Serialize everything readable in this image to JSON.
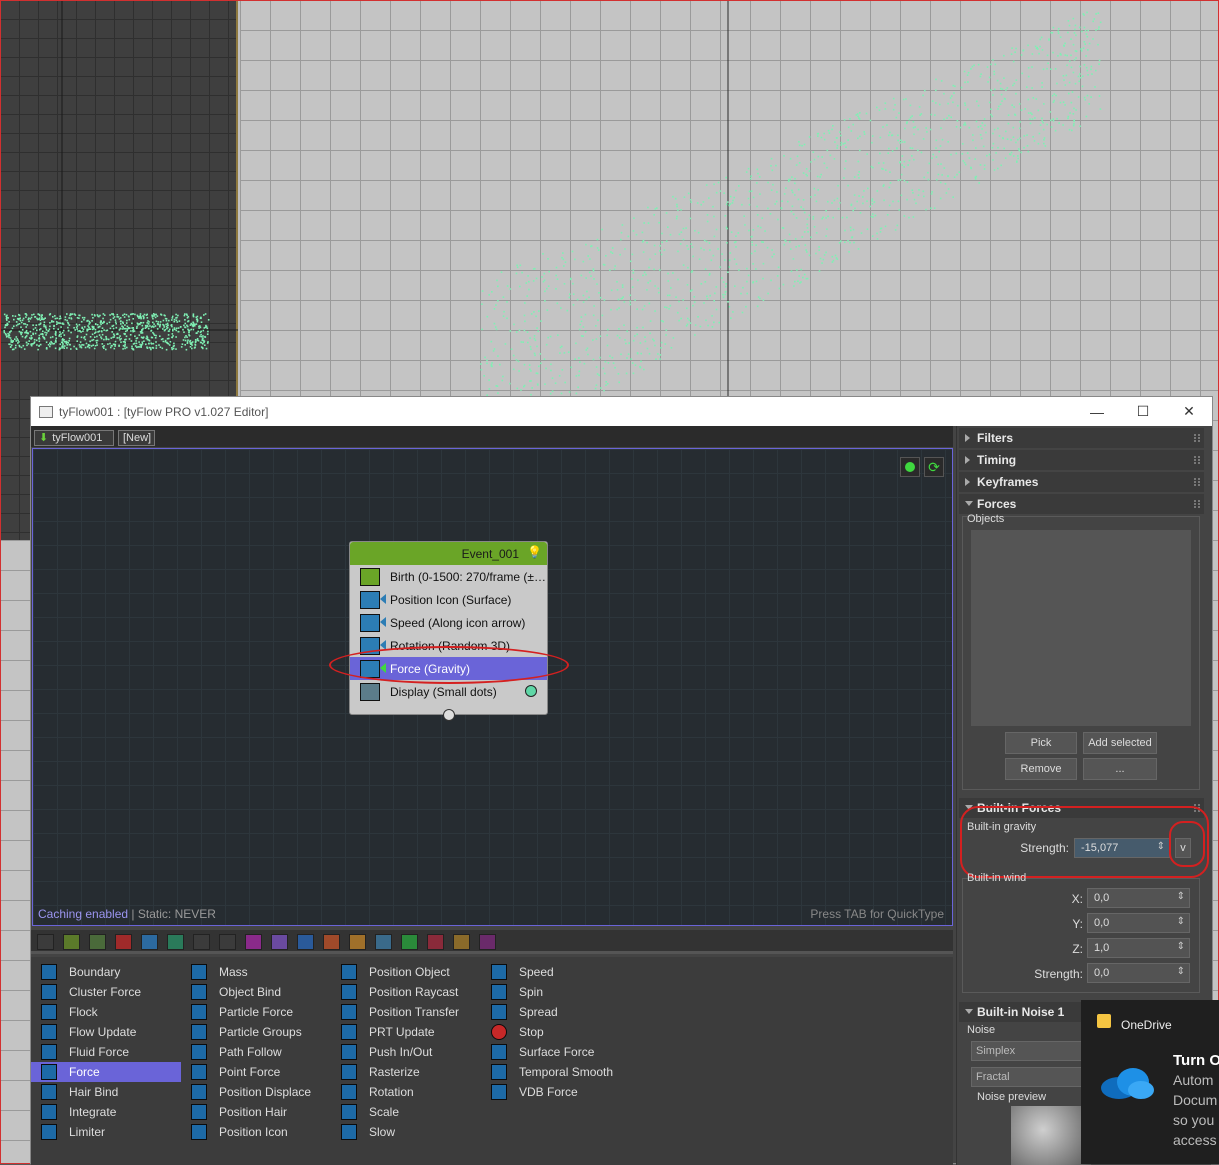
{
  "window": {
    "title": "tyFlow001 : [tyFlow PRO v1.027 Editor]",
    "minimize": "—",
    "maximize": "☐",
    "close": "✕"
  },
  "tabs": [
    {
      "label": "tyFlow001"
    },
    {
      "label": "[New]"
    }
  ],
  "event": {
    "name": "Event_001",
    "operators": [
      {
        "label": "Birth (0-1500: 270/frame (±…"
      },
      {
        "label": "Position Icon (Surface)"
      },
      {
        "label": "Speed (Along icon arrow)"
      },
      {
        "label": "Rotation (Random 3D)"
      },
      {
        "label": "Force (Gravity)",
        "selected": true
      },
      {
        "label": "Display (Small dots)"
      }
    ]
  },
  "canvas": {
    "caching": "Caching enabled",
    "separator": "|",
    "static": "Static: NEVER",
    "hint": "Press TAB for QuickType"
  },
  "operator_list": {
    "col1": [
      "Boundary",
      "Cluster Force",
      "Flock",
      "Flow Update",
      "Fluid Force",
      "Force",
      "Hair Bind",
      "Integrate",
      "Limiter"
    ],
    "col2": [
      "Mass",
      "Object Bind",
      "Particle Force",
      "Particle Groups",
      "Path Follow",
      "Point Force",
      "Position Displace",
      "Position Hair",
      "Position Icon"
    ],
    "col3": [
      "Position Object",
      "Position Raycast",
      "Position Transfer",
      "PRT Update",
      "Push In/Out",
      "Rasterize",
      "Rotation",
      "Scale",
      "Slow"
    ],
    "col4": [
      "Speed",
      "Spin",
      "Spread",
      "Stop",
      "Surface Force",
      "Temporal Smooth",
      "VDB Force"
    ],
    "selected": "Force"
  },
  "right_panel": {
    "filters": "Filters",
    "timing": "Timing",
    "keyframes": "Keyframes",
    "forces": "Forces",
    "objects_label": "Objects",
    "pick": "Pick",
    "add_selected": "Add selected",
    "remove": "Remove",
    "more": "...",
    "builtin_forces": "Built-in Forces",
    "builtin_gravity": "Built-in gravity",
    "strength_label": "Strength:",
    "gravity_strength": "-15,077",
    "v_button": "v",
    "builtin_wind": "Built-in wind",
    "x_label": "X:",
    "x_value": "0,0",
    "y_label": "Y:",
    "y_value": "0,0",
    "z_label": "Z:",
    "z_value": "1,0",
    "wind_strength_label": "Strength:",
    "wind_strength": "0,0",
    "builtin_noise": "Built-in Noise 1",
    "noise_label": "Noise",
    "noise_type": "Simplex",
    "noise_mode": "Fractal",
    "noise_preview": "Noise preview"
  },
  "onedrive": {
    "app": "OneDrive",
    "heading": "Turn O",
    "line1": "Autom",
    "line2": "Docum",
    "line3": "so you",
    "line4": "access"
  },
  "colors": {
    "particle": "#7ff0b4",
    "selection": "#6a64d8",
    "event_header": "#6aa527",
    "annotation": "#d42020"
  }
}
